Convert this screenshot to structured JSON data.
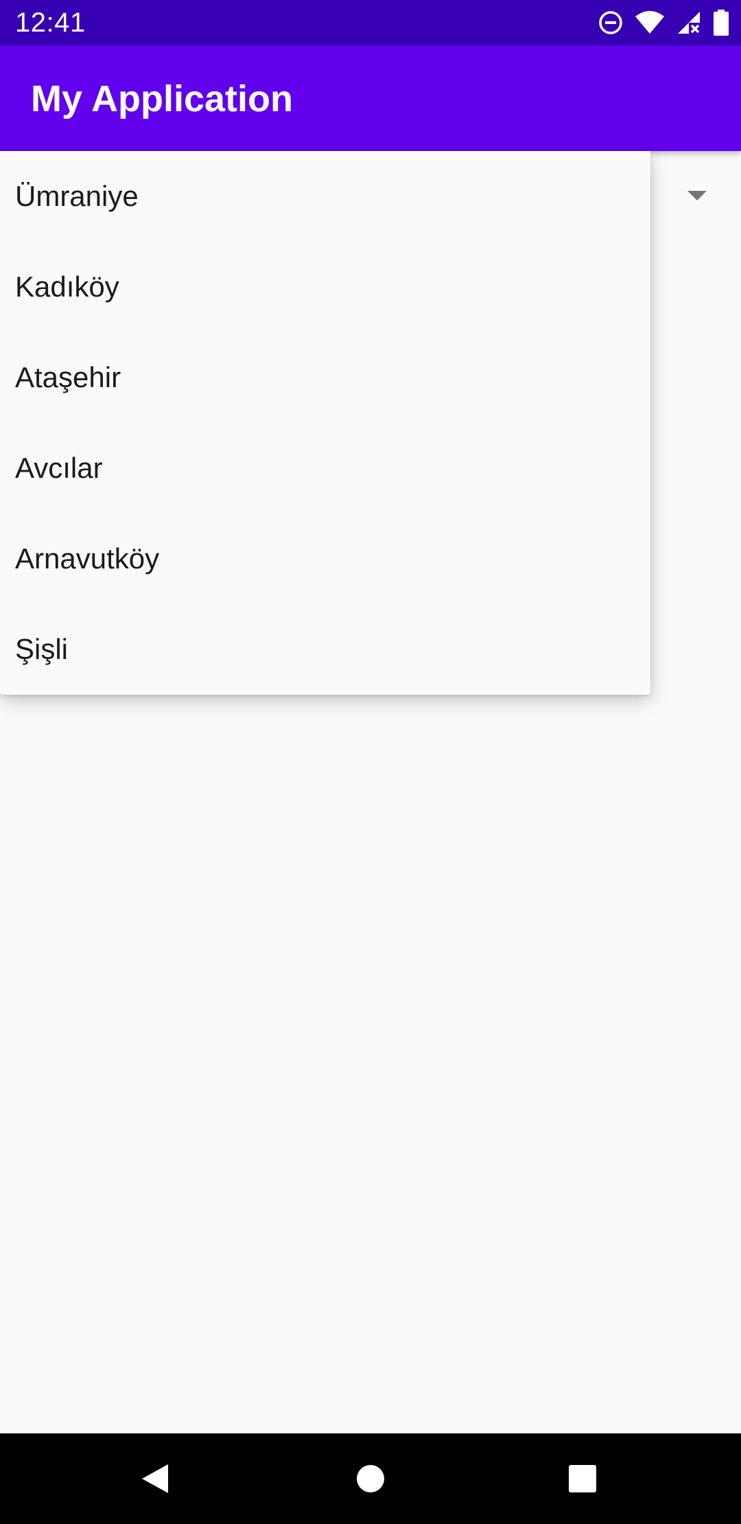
{
  "status_bar": {
    "time": "12:41",
    "icons": [
      "do-not-disturb-icon",
      "wifi-icon",
      "signal-no-data-icon",
      "battery-icon"
    ]
  },
  "app_bar": {
    "title": "My Application",
    "color": "#6200ee"
  },
  "dropdown": {
    "items": [
      {
        "label": "Ümraniye"
      },
      {
        "label": "Kadıköy"
      },
      {
        "label": "Ataşehir"
      },
      {
        "label": "Avcılar"
      },
      {
        "label": "Arnavutköy"
      },
      {
        "label": "Şişli"
      }
    ]
  },
  "nav_bar": {
    "buttons": [
      "back-icon",
      "home-icon",
      "recents-icon"
    ]
  },
  "colors": {
    "status_bar": "#3700b3",
    "primary": "#6200ee",
    "background": "#fafafa",
    "nav_bar": "#000000"
  }
}
